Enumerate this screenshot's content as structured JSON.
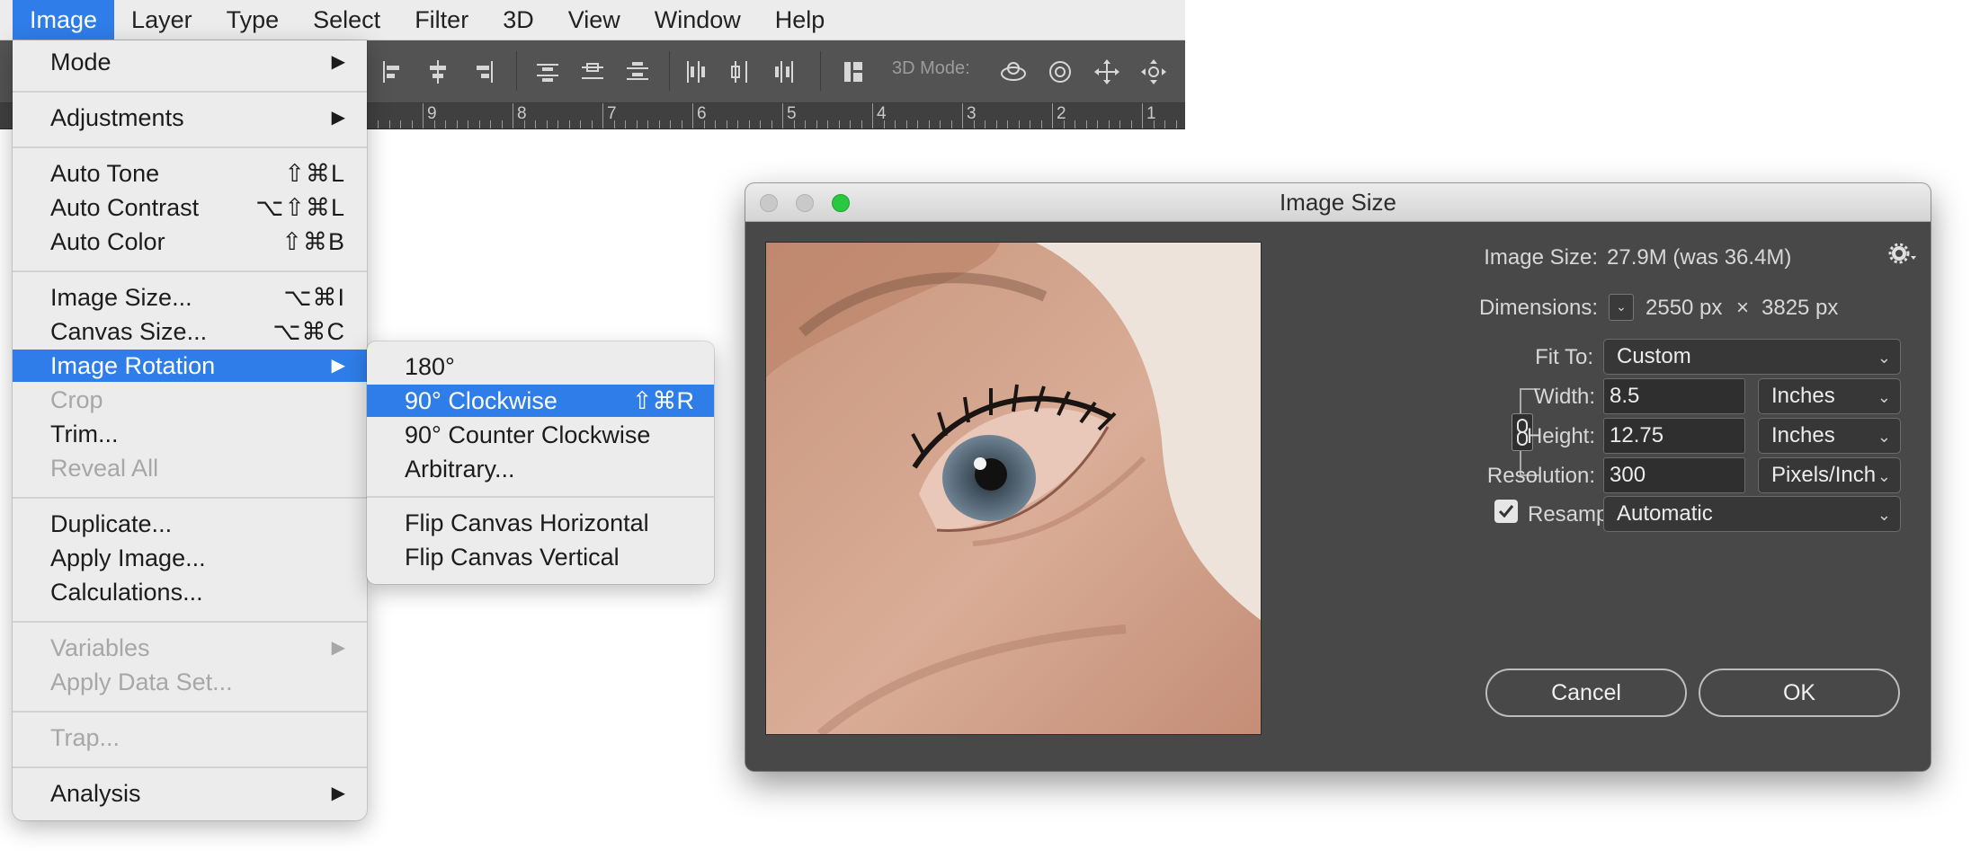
{
  "menubar": {
    "items": [
      "Image",
      "Layer",
      "Type",
      "Select",
      "Filter",
      "3D",
      "View",
      "Window",
      "Help"
    ],
    "active": "Image"
  },
  "toolbar": {
    "mode_3d_label": "3D Mode:"
  },
  "ruler": {
    "labels": [
      "9",
      "8",
      "7",
      "6",
      "5",
      "4",
      "3",
      "2",
      "1"
    ]
  },
  "image_menu": {
    "items": [
      {
        "label": "Mode",
        "submenu": true
      },
      {
        "label": "Adjustments",
        "submenu": true
      },
      {
        "label": "Auto Tone",
        "shortcut": "⇧⌘L"
      },
      {
        "label": "Auto Contrast",
        "shortcut": "⌥⇧⌘L"
      },
      {
        "label": "Auto Color",
        "shortcut": "⇧⌘B"
      },
      {
        "label": "Image Size...",
        "shortcut": "⌥⌘I"
      },
      {
        "label": "Canvas Size...",
        "shortcut": "⌥⌘C"
      },
      {
        "label": "Image Rotation",
        "submenu": true,
        "highlighted": true
      },
      {
        "label": "Crop",
        "disabled": true
      },
      {
        "label": "Trim..."
      },
      {
        "label": "Reveal All",
        "disabled": true
      },
      {
        "label": "Duplicate..."
      },
      {
        "label": "Apply Image..."
      },
      {
        "label": "Calculations..."
      },
      {
        "label": "Variables",
        "submenu": true,
        "disabled": true
      },
      {
        "label": "Apply Data Set...",
        "disabled": true
      },
      {
        "label": "Trap...",
        "disabled": true
      },
      {
        "label": "Analysis",
        "submenu": true
      }
    ]
  },
  "rotation_menu": {
    "items": [
      {
        "label": "180°"
      },
      {
        "label": "90° Clockwise",
        "shortcut": "⇧⌘R",
        "highlighted": true
      },
      {
        "label": "90° Counter Clockwise"
      },
      {
        "label": "Arbitrary..."
      },
      {
        "label": "Flip Canvas Horizontal"
      },
      {
        "label": "Flip Canvas Vertical"
      }
    ]
  },
  "dialog": {
    "title": "Image Size",
    "image_size_label": "Image Size:",
    "image_size_value": "27.9M (was 36.4M)",
    "dimensions_label": "Dimensions:",
    "dim_width": "2550 px",
    "dim_times": "×",
    "dim_height": "3825 px",
    "fit_to_label": "Fit To:",
    "fit_to_value": "Custom",
    "width_label": "Width:",
    "width_value": "8.5",
    "width_unit": "Inches",
    "height_label": "Height:",
    "height_value": "12.75",
    "height_unit": "Inches",
    "resolution_label": "Resolution:",
    "resolution_value": "300",
    "resolution_unit": "Pixels/Inch",
    "resample_label": "Resample:",
    "resample_checked": true,
    "resample_value": "Automatic",
    "cancel_label": "Cancel",
    "ok_label": "OK"
  },
  "colors": {
    "menu_highlight": "#2f7de9",
    "dialog_bg": "#484848",
    "traffic_green": "#28c840"
  }
}
